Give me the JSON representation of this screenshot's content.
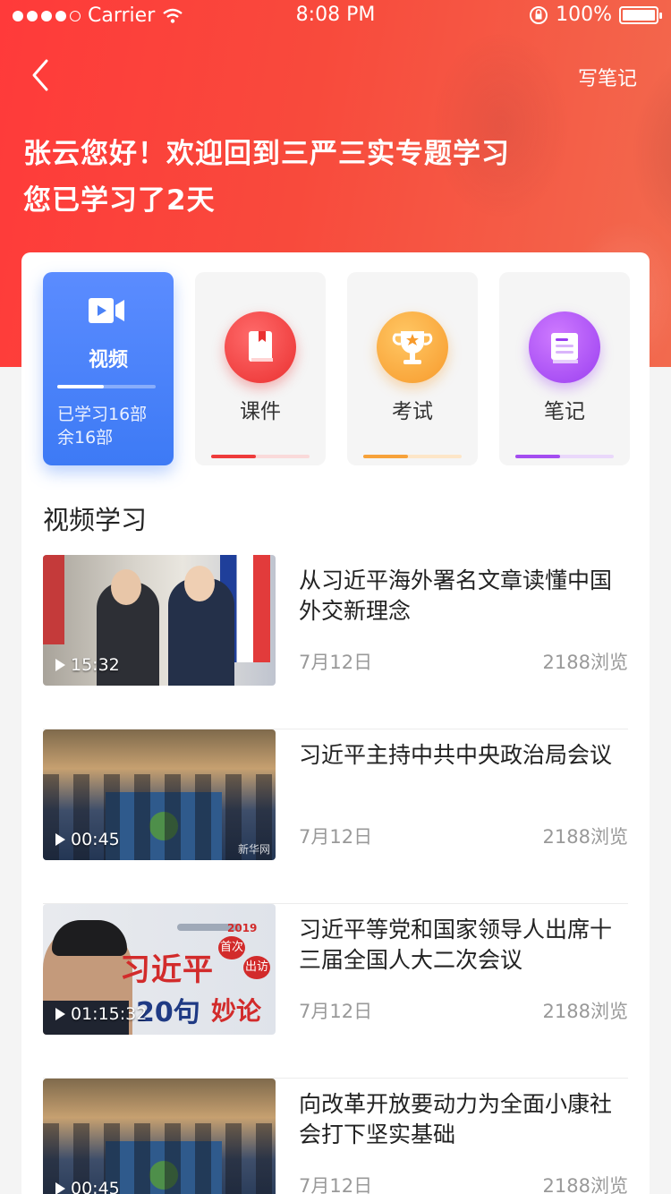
{
  "status_bar": {
    "carrier": "Carrier",
    "time": "8:08 PM",
    "battery": "100%"
  },
  "header": {
    "action_label": "写笔记",
    "greeting": "张云您好！欢迎回到三严三实专题学习",
    "days": "您已学习了2天"
  },
  "categories": [
    {
      "label": "视频",
      "progress_text": "已学习16部",
      "remaining_text": "余16部",
      "progress": 0.47,
      "active": true,
      "color": "#3d7af5"
    },
    {
      "label": "课件",
      "progress": 0.45,
      "active": false,
      "color": "#ee3b3b",
      "icon": "book-icon"
    },
    {
      "label": "考试",
      "progress": 0.45,
      "active": false,
      "color": "#f7a23a",
      "icon": "trophy-icon"
    },
    {
      "label": "笔记",
      "progress": 0.45,
      "active": false,
      "color": "#a44df0",
      "icon": "notebook-icon"
    }
  ],
  "section": {
    "title": "视频学习"
  },
  "videos": [
    {
      "title": "从习近平海外署名文章读懂中国外交新理念",
      "duration": "15:32",
      "date": "7月12日",
      "views": "2188浏览"
    },
    {
      "title": "习近平主持中共中央政治局会议",
      "duration": "00:45",
      "date": "7月12日",
      "views": "2188浏览"
    },
    {
      "title": "习近平等党和国家领导人出席十三届全国人大二次会议",
      "duration": "01:15:32",
      "date": "7月12日",
      "views": "2188浏览"
    },
    {
      "title": "向改革开放要动力为全面小康社会打下坚实基础",
      "duration": "00:45",
      "date": "7月12日",
      "views": "2188浏览"
    }
  ],
  "thumb_text": {
    "watermark": "新华网",
    "year": "2019",
    "headline": "习近平",
    "tag_a": "首次",
    "tag_b": "出访",
    "count": "20句",
    "word": "妙论"
  },
  "colors": {
    "brand_red": "#ff3a3a",
    "active_blue": "#3d7af5"
  }
}
